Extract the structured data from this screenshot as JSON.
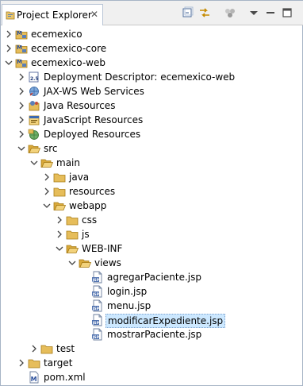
{
  "view": {
    "tab_title": "Project Explorer",
    "tab_close": "✕",
    "toolbar": [
      "collapse-all-icon",
      "link-with-editor-icon",
      "filters-icon",
      "view-menu-icon",
      "minimize-icon",
      "maximize-icon"
    ]
  },
  "tree": [
    {
      "label": "ecemexico",
      "depth": 0,
      "expanded": false,
      "icon": "maven-project-icon"
    },
    {
      "label": "ecemexico-core",
      "depth": 0,
      "expanded": false,
      "icon": "maven-project-icon"
    },
    {
      "label": "ecemexico-web",
      "depth": 0,
      "expanded": true,
      "icon": "maven-project-icon"
    },
    {
      "label": "Deployment Descriptor: ecemexico-web",
      "depth": 1,
      "expanded": false,
      "icon": "deployment-descriptor-icon"
    },
    {
      "label": "JAX-WS Web Services",
      "depth": 1,
      "expanded": false,
      "icon": "web-services-icon"
    },
    {
      "label": "Java Resources",
      "depth": 1,
      "expanded": false,
      "icon": "java-resources-icon"
    },
    {
      "label": "JavaScript Resources",
      "depth": 1,
      "expanded": false,
      "icon": "javascript-resources-icon"
    },
    {
      "label": "Deployed Resources",
      "depth": 1,
      "expanded": false,
      "icon": "deployed-resources-icon"
    },
    {
      "label": "src",
      "depth": 1,
      "expanded": true,
      "icon": "folder-open-icon"
    },
    {
      "label": "main",
      "depth": 2,
      "expanded": true,
      "icon": "folder-open-icon"
    },
    {
      "label": "java",
      "depth": 3,
      "expanded": false,
      "icon": "folder-icon"
    },
    {
      "label": "resources",
      "depth": 3,
      "expanded": false,
      "icon": "folder-icon"
    },
    {
      "label": "webapp",
      "depth": 3,
      "expanded": true,
      "icon": "folder-open-icon"
    },
    {
      "label": "css",
      "depth": 4,
      "expanded": false,
      "icon": "folder-icon"
    },
    {
      "label": "js",
      "depth": 4,
      "expanded": false,
      "icon": "folder-icon"
    },
    {
      "label": "WEB-INF",
      "depth": 4,
      "expanded": true,
      "icon": "folder-open-icon"
    },
    {
      "label": "views",
      "depth": 5,
      "expanded": true,
      "icon": "folder-open-icon"
    },
    {
      "label": "agregarPaciente.jsp",
      "depth": 6,
      "expanded": null,
      "icon": "jsp-file-icon"
    },
    {
      "label": "login.jsp",
      "depth": 6,
      "expanded": null,
      "icon": "jsp-file-icon"
    },
    {
      "label": "menu.jsp",
      "depth": 6,
      "expanded": null,
      "icon": "jsp-file-icon"
    },
    {
      "label": "modificarExpediente.jsp",
      "depth": 6,
      "expanded": null,
      "icon": "jsp-file-icon",
      "selected": true
    },
    {
      "label": "mostrarPaciente.jsp",
      "depth": 6,
      "expanded": null,
      "icon": "jsp-file-icon"
    },
    {
      "label": "test",
      "depth": 2,
      "expanded": false,
      "icon": "folder-icon"
    },
    {
      "label": "target",
      "depth": 1,
      "expanded": false,
      "icon": "folder-icon"
    },
    {
      "label": "pom.xml",
      "depth": 1,
      "expanded": null,
      "icon": "maven-pom-icon"
    }
  ]
}
